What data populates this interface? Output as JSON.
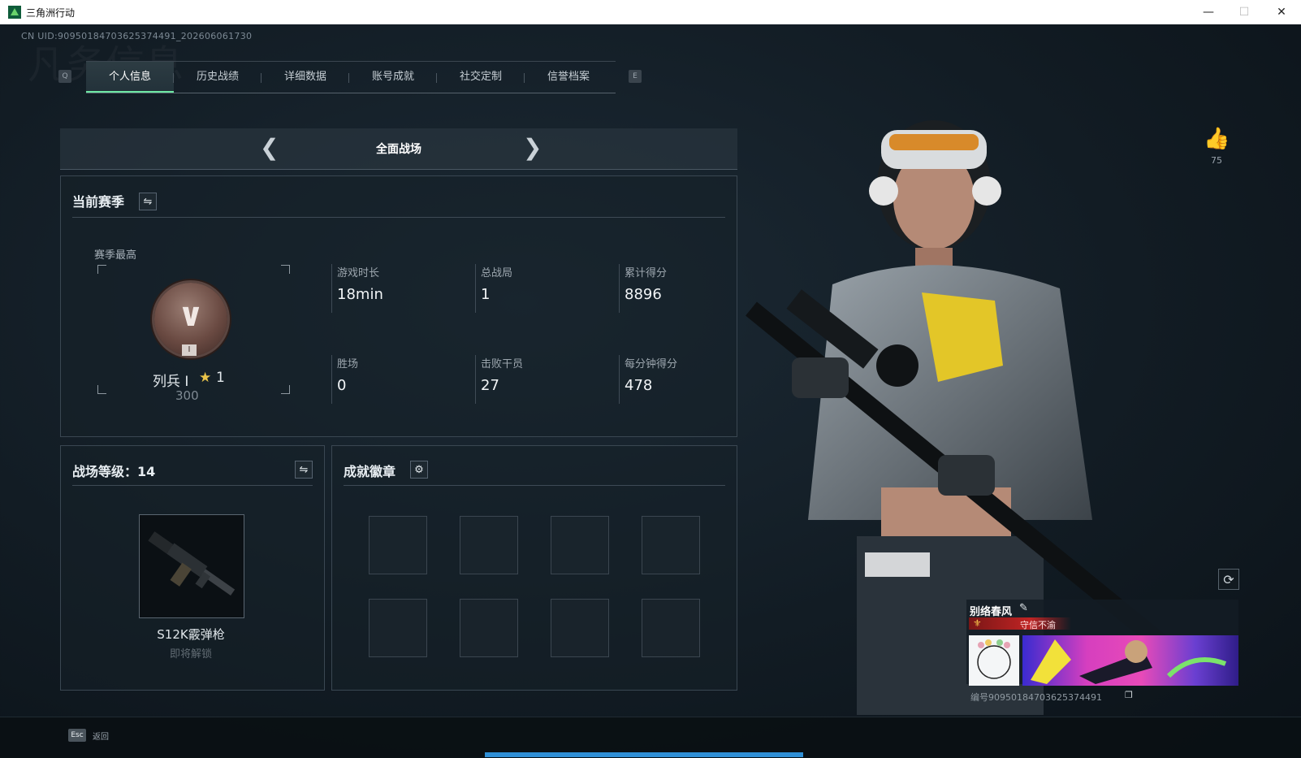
{
  "window": {
    "title": "三角洲行动"
  },
  "uid": "CN UID:9095018470362537449​1_202606061730",
  "tab_hints": {
    "left": "Q",
    "right": "E"
  },
  "tabs": [
    "个人信息",
    "历史战绩",
    "详细数据",
    "账号成就",
    "社交定制",
    "信誉档案"
  ],
  "active_tab": 0,
  "mode": {
    "title": "全面战场"
  },
  "current_season": {
    "heading": "当前赛季",
    "season_best_label": "赛季最高",
    "rank_name": "列兵",
    "rank_roman": "I",
    "rank_stars": "1",
    "rank_score": "300",
    "stats": [
      {
        "label": "游戏时长",
        "value": "18min"
      },
      {
        "label": "总战局",
        "value": "1"
      },
      {
        "label": "累计得分",
        "value": "8896"
      },
      {
        "label": "胜场",
        "value": "0"
      },
      {
        "label": "击败干员",
        "value": "27"
      },
      {
        "label": "每分钟得分",
        "value": "478"
      }
    ]
  },
  "battlefield_level": {
    "heading": "战场等级：14",
    "weapon_name": "S12K霰弹枪",
    "weapon_status": "即将解锁"
  },
  "achievements": {
    "heading": "成就徽章",
    "slots": 8
  },
  "likes": {
    "count": "75"
  },
  "profile_card": {
    "name": "别络春风",
    "title": "守信不渝",
    "id": "编号909501847036253744​91"
  },
  "footer": {
    "esc_key": "Esc",
    "esc_label": "返回"
  },
  "colors": {
    "accent": "#6ee8a4",
    "progress": "#2f8fd6",
    "title_red": "#c02424"
  }
}
